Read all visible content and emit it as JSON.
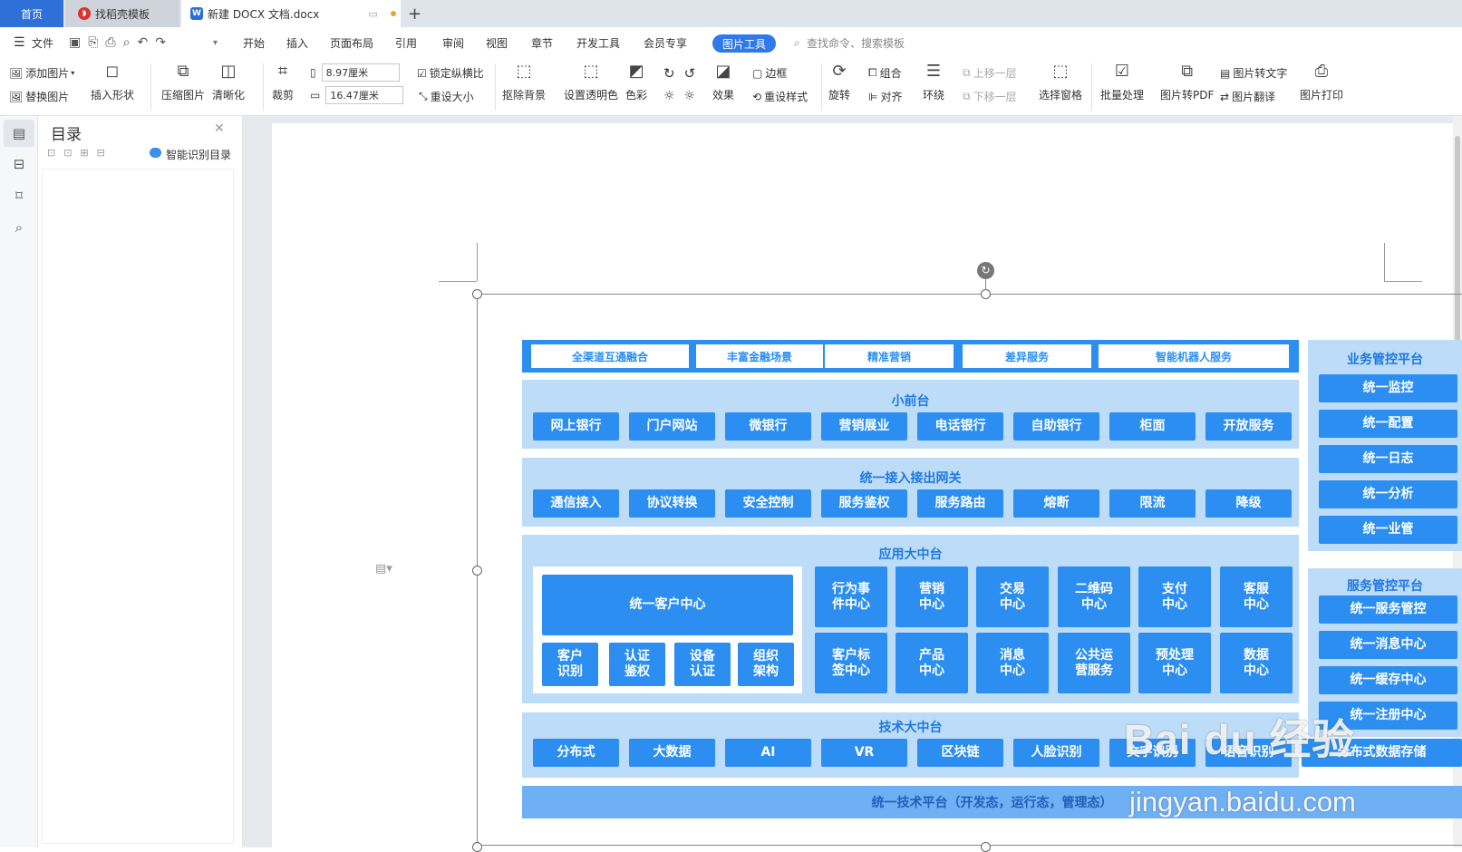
{
  "tabs": {
    "home": "首页",
    "template": "找稻壳模板",
    "doc": "新建 DOCX 文档.docx",
    "add": "+"
  },
  "menu": {
    "file": "文件",
    "items": [
      "开始",
      "插入",
      "页面布局",
      "引用",
      "审阅",
      "视图",
      "章节",
      "开发工具",
      "会员专享"
    ],
    "active": "图片工具",
    "search": "查找命令、搜索模板"
  },
  "ribbon": {
    "add_image": "添加图片",
    "replace_image": "替换图片",
    "insert_shape": "插入形状",
    "compress": "压缩图片",
    "sharpen": "清晰化",
    "crop": "裁剪",
    "width": "8.97厘米",
    "height": "16.47厘米",
    "lock_ratio": "锁定纵横比",
    "reset_size": "重设大小",
    "remove_bg": "抠除背景",
    "set_transparent": "设置透明色",
    "color": "色彩",
    "effect": "效果",
    "border": "边框",
    "reset_style": "重设样式",
    "rotate": "旋转",
    "group": "组合",
    "align": "对齐",
    "wrap": "环绕",
    "bring_forward": "上移一层",
    "send_backward": "下移一层",
    "select_pane": "选择窗格",
    "batch": "批量处理",
    "to_pdf": "图片转PDF",
    "to_text": "图片转文字",
    "translate": "图片翻译",
    "print": "图片打印"
  },
  "toc": {
    "title": "目录",
    "smart": "智能识别目录"
  },
  "diagram": {
    "top_items": [
      "全渠道互通融合",
      "丰富金融场景",
      "精准营销",
      "差异服务",
      "智能机器人服务"
    ],
    "front": {
      "title": "小前台",
      "items": [
        "网上银行",
        "门户网站",
        "微银行",
        "营销展业",
        "电话银行",
        "自助银行",
        "柜面",
        "开放服务"
      ]
    },
    "gateway": {
      "title": "统一接入接出网关",
      "items": [
        "通信接入",
        "协议转换",
        "安全控制",
        "服务鉴权",
        "服务路由",
        "熔断",
        "限流",
        "降级"
      ]
    },
    "app": {
      "title": "应用大中台",
      "customer_center": "统一客户中心",
      "sub": [
        "客户\n识别",
        "认证\n鉴权",
        "设备\n认证",
        "组织\n架构"
      ],
      "row1": [
        "行为事\n件中心",
        "营销\n中心",
        "交易\n中心",
        "二维码\n中心",
        "支付\n中心",
        "客服\n中心"
      ],
      "row2": [
        "客户标\n签中心",
        "产品\n中心",
        "消息\n中心",
        "公共运\n营服务",
        "预处理\n中心",
        "数据\n中心"
      ]
    },
    "tech": {
      "title": "技术大中台",
      "items": [
        "分布式",
        "大数据",
        "AI",
        "VR",
        "区块链",
        "人脸识别",
        "文字识别",
        "语音识别",
        "分布式数据存储"
      ]
    },
    "platform": "统一技术平台（开发态，运行态，管理态）",
    "biz": {
      "title": "业务管控平台",
      "items": [
        "统一监控",
        "统一配置",
        "统一日志",
        "统一分析",
        "统一业管"
      ]
    },
    "svc": {
      "title": "服务管控平台",
      "items": [
        "统一服务管控",
        "统一消息中心",
        "统一缓存中心",
        "统一注册中心"
      ]
    }
  },
  "watermark": {
    "logo": "Bai du 经验",
    "url": "jingyan.baidu.com"
  }
}
